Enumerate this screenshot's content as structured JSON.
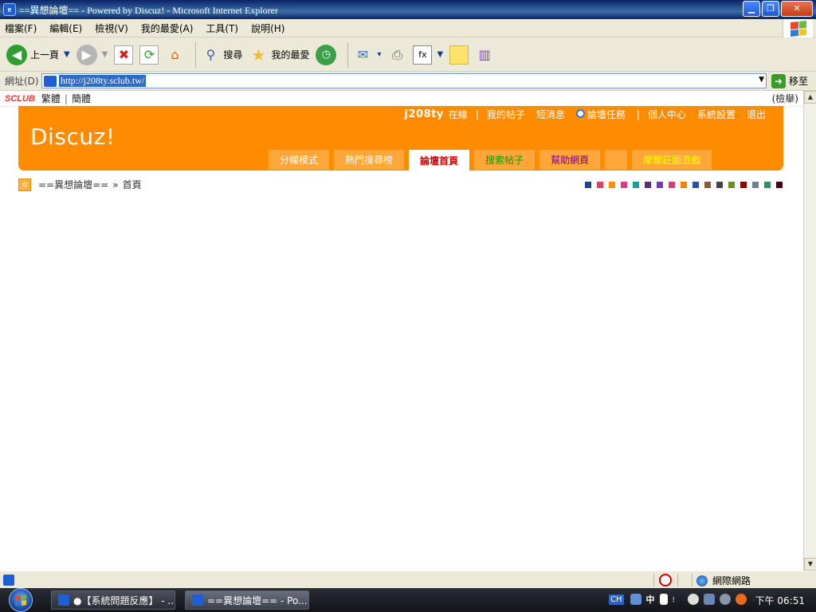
{
  "window": {
    "title": "==異想論壇== - Powered by Discuz! - Microsoft Internet Explorer",
    "buttons": [
      "minimize",
      "restore",
      "close"
    ]
  },
  "menubar": {
    "items": [
      "檔案(F)",
      "編輯(E)",
      "檢視(V)",
      "我的最愛(A)",
      "工具(T)",
      "說明(H)"
    ]
  },
  "toolbar": {
    "back_label": "上一頁",
    "search_label": "搜尋",
    "favorites_label": "我的最愛"
  },
  "address": {
    "label": "網址(D)",
    "url": "http://j208ty.sclub.tw/",
    "go_label": "移至"
  },
  "sclub": {
    "logo_text": "SCLUB",
    "traditional": "繁體",
    "simplified": "簡體",
    "report": "(檢舉)"
  },
  "forum": {
    "brand": "Discuz!",
    "username": "j208ty",
    "online": "在線",
    "my_posts": "我的帖子",
    "messages": "短消息",
    "tasks": "論壇任務",
    "user_center": "個人中心",
    "settings": "系統設置",
    "logout": "退出",
    "tabs": [
      {
        "label": "分欄模式",
        "color": "#ffffff"
      },
      {
        "label": "熱門搜尋榜",
        "color": "#ffffff"
      },
      {
        "label": "論壇首頁",
        "color": "#d40000",
        "active": true
      },
      {
        "label": "搜索帖子",
        "color": "#00a000"
      },
      {
        "label": "幫助網頁",
        "color": "#7a0090"
      },
      {
        "label": "",
        "color": "#ffffff"
      },
      {
        "label": "摩爾莊園遊戲",
        "color": "#ffff00"
      }
    ],
    "accent_color": "#ff8c00"
  },
  "breadcrumb": {
    "site": "==異想論壇==",
    "separator": "»",
    "current": "首頁"
  },
  "style_swatches": [
    "#224488",
    "#e04060",
    "#ff8c00",
    "#d63b8f",
    "#1a9e9e",
    "#5a2d7a",
    "#6d3fb0",
    "#d23c84",
    "#ff7f00",
    "#2255aa",
    "#8a5a3a",
    "#444444",
    "#6b8e23",
    "#8b0000",
    "#708090",
    "#2f8f6f",
    "#4b0010"
  ],
  "statusbar": {
    "zone": "網際網路"
  },
  "taskbar": {
    "tasks": [
      {
        "label": "●【系統問題反應】 - ..."
      },
      {
        "label": "==異想論壇== - Po..."
      }
    ],
    "ime": "CH",
    "ime_mode": "中",
    "clock": "下午 06:51"
  }
}
